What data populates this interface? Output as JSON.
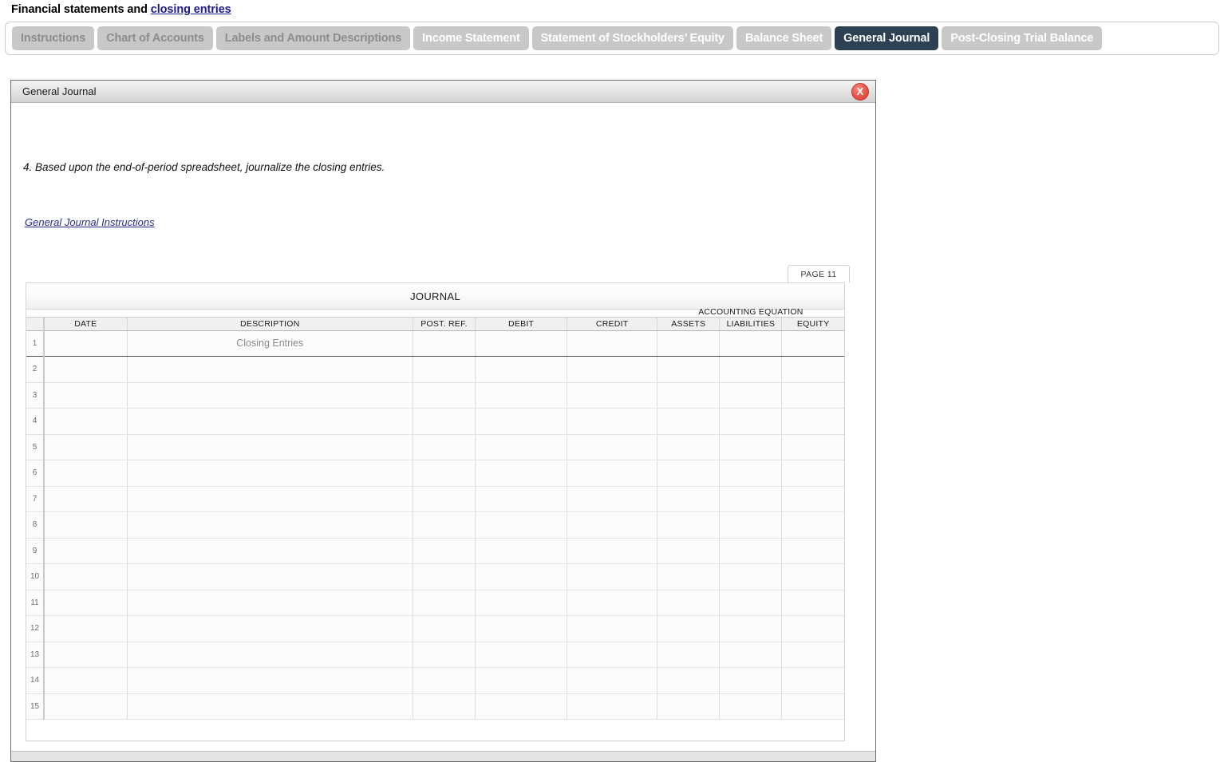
{
  "page": {
    "title_prefix": "Financial statements and ",
    "title_link": "closing entries"
  },
  "tabs": [
    {
      "label": "Instructions",
      "state": "dim"
    },
    {
      "label": "Chart of Accounts",
      "state": "dim"
    },
    {
      "label": "Labels and Amount Descriptions",
      "state": "dim"
    },
    {
      "label": "Income Statement",
      "state": "normal"
    },
    {
      "label": "Statement of Stockholders’ Equity",
      "state": "normal"
    },
    {
      "label": "Balance Sheet",
      "state": "normal"
    },
    {
      "label": "General Journal",
      "state": "active"
    },
    {
      "label": "Post-Closing Trial Balance",
      "state": "normal"
    }
  ],
  "panel": {
    "title": "General Journal",
    "close_label": "X",
    "instruction": "4. Based upon the end-of-period spreadsheet, journalize the closing entries.",
    "instructions_link": "General Journal Instructions"
  },
  "journal": {
    "page_tab": "PAGE 11",
    "title": "JOURNAL",
    "group_header": "ACCOUNTING EQUATION",
    "columns": [
      "DATE",
      "DESCRIPTION",
      "POST. REF.",
      "DEBIT",
      "CREDIT",
      "ASSETS",
      "LIABILITIES",
      "EQUITY"
    ],
    "rows": [
      {
        "num": "1",
        "date": "",
        "description": "Closing Entries",
        "post_ref": "",
        "debit": "",
        "credit": "",
        "assets": "",
        "liabilities": "",
        "equity": ""
      },
      {
        "num": "2",
        "date": "",
        "description": "",
        "post_ref": "",
        "debit": "",
        "credit": "",
        "assets": "",
        "liabilities": "",
        "equity": ""
      },
      {
        "num": "3",
        "date": "",
        "description": "",
        "post_ref": "",
        "debit": "",
        "credit": "",
        "assets": "",
        "liabilities": "",
        "equity": ""
      },
      {
        "num": "4",
        "date": "",
        "description": "",
        "post_ref": "",
        "debit": "",
        "credit": "",
        "assets": "",
        "liabilities": "",
        "equity": ""
      },
      {
        "num": "5",
        "date": "",
        "description": "",
        "post_ref": "",
        "debit": "",
        "credit": "",
        "assets": "",
        "liabilities": "",
        "equity": ""
      },
      {
        "num": "6",
        "date": "",
        "description": "",
        "post_ref": "",
        "debit": "",
        "credit": "",
        "assets": "",
        "liabilities": "",
        "equity": ""
      },
      {
        "num": "7",
        "date": "",
        "description": "",
        "post_ref": "",
        "debit": "",
        "credit": "",
        "assets": "",
        "liabilities": "",
        "equity": ""
      },
      {
        "num": "8",
        "date": "",
        "description": "",
        "post_ref": "",
        "debit": "",
        "credit": "",
        "assets": "",
        "liabilities": "",
        "equity": ""
      },
      {
        "num": "9",
        "date": "",
        "description": "",
        "post_ref": "",
        "debit": "",
        "credit": "",
        "assets": "",
        "liabilities": "",
        "equity": ""
      },
      {
        "num": "10",
        "date": "",
        "description": "",
        "post_ref": "",
        "debit": "",
        "credit": "",
        "assets": "",
        "liabilities": "",
        "equity": ""
      },
      {
        "num": "11",
        "date": "",
        "description": "",
        "post_ref": "",
        "debit": "",
        "credit": "",
        "assets": "",
        "liabilities": "",
        "equity": ""
      },
      {
        "num": "12",
        "date": "",
        "description": "",
        "post_ref": "",
        "debit": "",
        "credit": "",
        "assets": "",
        "liabilities": "",
        "equity": ""
      },
      {
        "num": "13",
        "date": "",
        "description": "",
        "post_ref": "",
        "debit": "",
        "credit": "",
        "assets": "",
        "liabilities": "",
        "equity": ""
      },
      {
        "num": "14",
        "date": "",
        "description": "",
        "post_ref": "",
        "debit": "",
        "credit": "",
        "assets": "",
        "liabilities": "",
        "equity": ""
      },
      {
        "num": "15",
        "date": "",
        "description": "",
        "post_ref": "",
        "debit": "",
        "credit": "",
        "assets": "",
        "liabilities": "",
        "equity": ""
      }
    ]
  },
  "colors": {
    "active_tab": "#2e4053",
    "inactive_tab": "#c8c8c8",
    "link": "#1a1a8c",
    "close_button": "#e8544a"
  }
}
